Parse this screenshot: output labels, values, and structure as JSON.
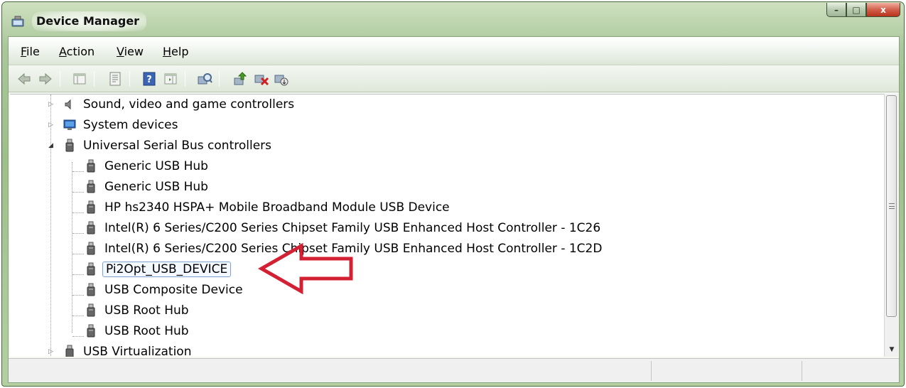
{
  "window": {
    "title": "Device Manager",
    "buttons": {
      "minimize": "–",
      "maximize": "□",
      "close": "x"
    }
  },
  "menubar": {
    "items": [
      {
        "label": "File",
        "accel": "F",
        "rest": "ile"
      },
      {
        "label": "Action",
        "accel": "A",
        "rest": "ction"
      },
      {
        "label": "View",
        "accel": "V",
        "rest": "iew"
      },
      {
        "label": "Help",
        "accel": "H",
        "rest": "elp"
      }
    ]
  },
  "toolbar": {
    "buttons": [
      "back-icon",
      "forward-icon",
      "show-hide-console-tree-icon",
      "properties-icon",
      "help-icon",
      "action-pane-icon",
      "scan-hardware-icon",
      "update-driver-icon",
      "uninstall-icon",
      "disable-icon"
    ]
  },
  "tree": {
    "categories": [
      {
        "label": "Sound, video and game controllers",
        "icon": "speaker-icon",
        "expanded": false
      },
      {
        "label": "System devices",
        "icon": "computer-icon",
        "expanded": false
      },
      {
        "label": "Universal Serial Bus controllers",
        "icon": "usb-icon",
        "expanded": true,
        "children": [
          "Generic USB Hub",
          "Generic USB Hub",
          "HP hs2340 HSPA+ Mobile Broadband Module USB Device",
          "Intel(R) 6 Series/C200 Series Chipset Family USB Enhanced Host Controller - 1C26",
          "Intel(R) 6 Series/C200 Series Chipset Family USB Enhanced Host Controller - 1C2D",
          "Pi2Opt_USB_DEVICE",
          "USB Composite Device",
          "USB Root Hub",
          "USB Root Hub"
        ]
      },
      {
        "label": "USB Virtualization",
        "icon": "usb-icon",
        "expanded": false
      }
    ],
    "selected": "Pi2Opt_USB_DEVICE"
  },
  "colors": {
    "frame": "#9ebf8c",
    "annotation_arrow": "#d42033",
    "selection_border": "#7da2ce"
  }
}
